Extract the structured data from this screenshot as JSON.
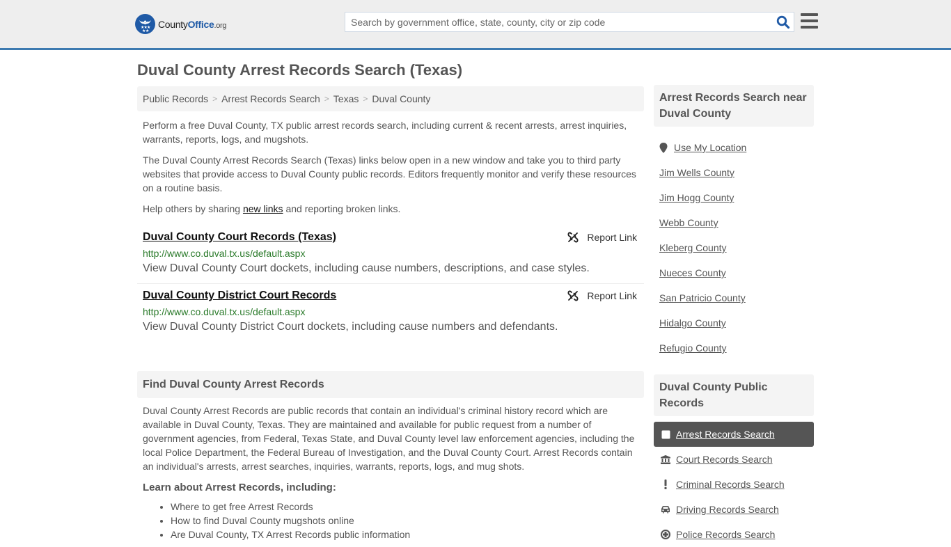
{
  "header": {
    "logo": {
      "name_part1": "County",
      "name_part2": "Office",
      "name_part3": ".org"
    },
    "search": {
      "placeholder": "Search by government office, state, county, city or zip code",
      "value": ""
    },
    "colors": {
      "brand": "#1f5aa6",
      "header_bg": "#eeeeee",
      "header_border": "#3d7ab0"
    }
  },
  "page": {
    "title": "Duval County Arrest Records Search (Texas)"
  },
  "breadcrumb": {
    "items": [
      "Public Records",
      "Arrest Records Search",
      "Texas",
      "Duval County"
    ],
    "separator": ">"
  },
  "intro": {
    "p1": "Perform a free Duval County, TX public arrest records search, including current & recent arrests, arrest inquiries, warrants, reports, logs, and mugshots.",
    "p2": "The Duval County Arrest Records Search (Texas) links below open in a new window and take you to third party websites that provide access to Duval County public records. Editors frequently monitor and verify these resources on a routine basis.",
    "p3_before": "Help others by sharing ",
    "p3_link": "new links",
    "p3_after": " and reporting broken links."
  },
  "links": [
    {
      "title": "Duval County Court Records (Texas)",
      "url": "http://www.co.duval.tx.us/default.aspx",
      "description": "View Duval County Court dockets, including cause numbers, descriptions, and case styles.",
      "report_label": "Report Link"
    },
    {
      "title": "Duval County District Court Records",
      "url": "http://www.co.duval.tx.us/default.aspx",
      "description": "View Duval County District Court dockets, including cause numbers and defendants.",
      "report_label": "Report Link"
    }
  ],
  "find_section": {
    "heading": "Find Duval County Arrest Records",
    "body": "Duval County Arrest Records are public records that contain an individual's criminal history record which are available in Duval County, Texas. They are maintained and available for public request from a number of government agencies, from Federal, Texas State, and Duval County level law enforcement agencies, including the local Police Department, the Federal Bureau of Investigation, and the Duval County Court. Arrest Records contain an individual's arrests, arrest searches, inquiries, warrants, reports, logs, and mug shots.",
    "learn_heading": "Learn about Arrest Records, including:",
    "learn_items": [
      "Where to get free Arrest Records",
      "How to find Duval County mugshots online",
      "Are Duval County, TX Arrest Records public information"
    ]
  },
  "sidebar": {
    "nearby_heading": "Arrest Records Search near Duval County",
    "use_location": "Use My Location",
    "nearby": [
      "Jim Wells County",
      "Jim Hogg County",
      "Webb County",
      "Kleberg County",
      "Nueces County",
      "San Patricio County",
      "Hidalgo County",
      "Refugio County"
    ],
    "public_records_heading": "Duval County Public Records",
    "public_records": [
      {
        "label": "Arrest Records Search",
        "icon": "square-icon",
        "active": true
      },
      {
        "label": "Court Records Search",
        "icon": "courthouse-icon",
        "active": false
      },
      {
        "label": "Criminal Records Search",
        "icon": "exclamation-icon",
        "active": false
      },
      {
        "label": "Driving Records Search",
        "icon": "car-icon",
        "active": false
      },
      {
        "label": "Police Records Search",
        "icon": "police-badge-icon",
        "active": false
      }
    ]
  }
}
